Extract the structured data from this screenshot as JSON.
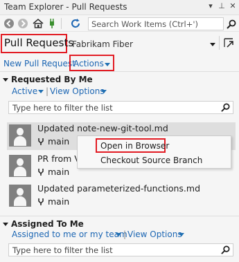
{
  "window": {
    "title": "Team Explorer - Pull Requests",
    "controls": [
      "▾",
      "⊥",
      "✕"
    ]
  },
  "toolbar": {
    "search_placeholder": "Search Work Items (Ctrl+')"
  },
  "header": {
    "title": "Pull Requests",
    "repository": "Fabrikam Fiber"
  },
  "actions": {
    "new_pull_request": "New Pull Request",
    "actions_menu": "Actions"
  },
  "requested_by_me": {
    "heading": "Requested By Me",
    "filter_active": "Active",
    "separator": "|",
    "view_options": "View Options",
    "filter_placeholder": "Type here to filter the list",
    "items": [
      {
        "title": "Updated note-new-git-tool.md",
        "branch": "main"
      },
      {
        "title": "PR from Vi",
        "branch": "main"
      },
      {
        "title": "Updated parameterized-functions.md",
        "branch": "main"
      }
    ]
  },
  "context_menu": {
    "items": [
      "Open in Browser",
      "Checkout Source Branch"
    ]
  },
  "assigned_to_me": {
    "heading": "Assigned To Me",
    "filter_assigned": "Assigned to me or my team",
    "separator": "|",
    "view_options": "View Options",
    "filter_placeholder": "Type here to filter the list"
  },
  "colors": {
    "accent_link": "#1c66b3",
    "highlight_box": "#e21b23",
    "selected_row": "#dedede"
  }
}
